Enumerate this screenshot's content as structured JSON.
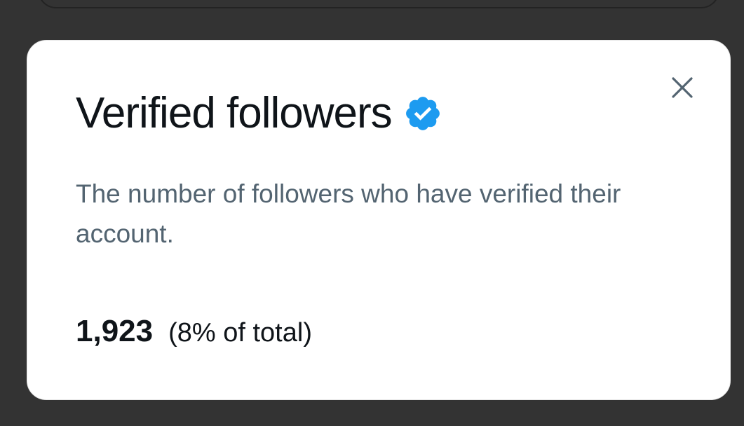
{
  "dialog": {
    "title": "Verified followers",
    "description": "The number of followers who have verified their account.",
    "count": "1,923",
    "percent_text": "(8% of total)",
    "close_icon": "close-icon",
    "badge_icon": "verified-badge-icon",
    "badge_color": "#1d9bf0"
  }
}
